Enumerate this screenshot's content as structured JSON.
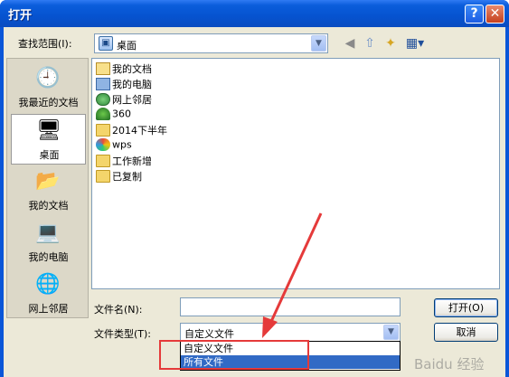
{
  "window": {
    "title": "打开",
    "help_glyph": "?",
    "close_glyph": "✕"
  },
  "toolbar": {
    "lookin_label": "查找范围(I):",
    "lookin_value": "桌面",
    "tools": [
      "back-icon",
      "up-folder-icon",
      "new-folder-icon",
      "views-menu-icon"
    ]
  },
  "places": [
    {
      "label": "我最近的文档",
      "icon": "recent-documents-icon"
    },
    {
      "label": "桌面",
      "icon": "desktop-icon",
      "selected": true
    },
    {
      "label": "我的文档",
      "icon": "my-documents-icon"
    },
    {
      "label": "我的电脑",
      "icon": "my-computer-icon"
    },
    {
      "label": "网上邻居",
      "icon": "network-places-icon"
    }
  ],
  "files": [
    {
      "name": "我的文档",
      "icon": "my-documents-icon"
    },
    {
      "name": "我的电脑",
      "icon": "my-computer-icon"
    },
    {
      "name": "网上邻居",
      "icon": "network-places-icon"
    },
    {
      "name": "360",
      "icon": "tree-icon"
    },
    {
      "name": "2014下半年",
      "icon": "folder-icon"
    },
    {
      "name": "wps",
      "icon": "wps-icon"
    },
    {
      "name": "工作新增",
      "icon": "folder-icon"
    },
    {
      "name": "已复制",
      "icon": "folder-icon"
    }
  ],
  "form": {
    "filename_label": "文件名(N):",
    "filename_value": "",
    "filetype_label": "文件类型(T):",
    "filetype_value": "自定义文件",
    "filetype_options": [
      "自定义文件",
      "所有文件"
    ],
    "filetype_highlighted": "所有文件"
  },
  "buttons": {
    "open": "打开(O)",
    "cancel": "取消"
  },
  "annotation": {
    "color": "#e53a3a"
  },
  "watermark": "Baidu 经验"
}
